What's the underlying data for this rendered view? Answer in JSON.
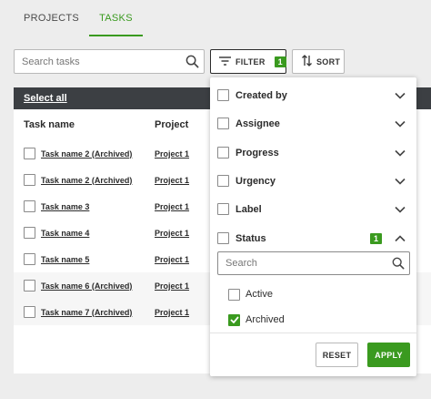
{
  "tabs": [
    {
      "label": "PROJECTS",
      "active": false
    },
    {
      "label": "TASKS",
      "active": true
    }
  ],
  "search": {
    "placeholder": "Search tasks",
    "value": ""
  },
  "toolbar": {
    "filter_label": "FILTER",
    "filter_count": "1",
    "sort_label": "SORT"
  },
  "table": {
    "select_all": "Select all",
    "columns": [
      "Task name",
      "Project"
    ],
    "rows": [
      {
        "task": "Task name 2 (Archived)",
        "project": "Project 1"
      },
      {
        "task": "Task name 2 (Archived)",
        "project": "Project 1"
      },
      {
        "task": "Task name 3",
        "project": "Project 1"
      },
      {
        "task": "Task name 4",
        "project": "Project 1"
      },
      {
        "task": "Task name 5",
        "project": "Project 1"
      },
      {
        "task": "Task name 6 (Archived)",
        "project": "Project 1"
      },
      {
        "task": "Task name 7 (Archived)",
        "project": "Project 1"
      }
    ]
  },
  "filter_panel": {
    "groups": [
      {
        "label": "Created by",
        "expanded": false
      },
      {
        "label": "Assignee",
        "expanded": false
      },
      {
        "label": "Progress",
        "expanded": false
      },
      {
        "label": "Urgency",
        "expanded": false
      },
      {
        "label": "Label",
        "expanded": false
      },
      {
        "label": "Status",
        "expanded": true,
        "count": "1"
      }
    ],
    "status_search_placeholder": "Search",
    "status_options": [
      {
        "label": "Active",
        "checked": false
      },
      {
        "label": "Archived",
        "checked": true
      }
    ],
    "reset_label": "RESET",
    "apply_label": "APPLY"
  },
  "colors": {
    "accent": "#3a9a1f",
    "dark_bar": "#3c3f43",
    "background": "#ededed"
  },
  "icons": [
    "search-icon",
    "filter-icon",
    "sort-icon",
    "chevron-down-icon",
    "chevron-up-icon",
    "checkmark-icon"
  ]
}
